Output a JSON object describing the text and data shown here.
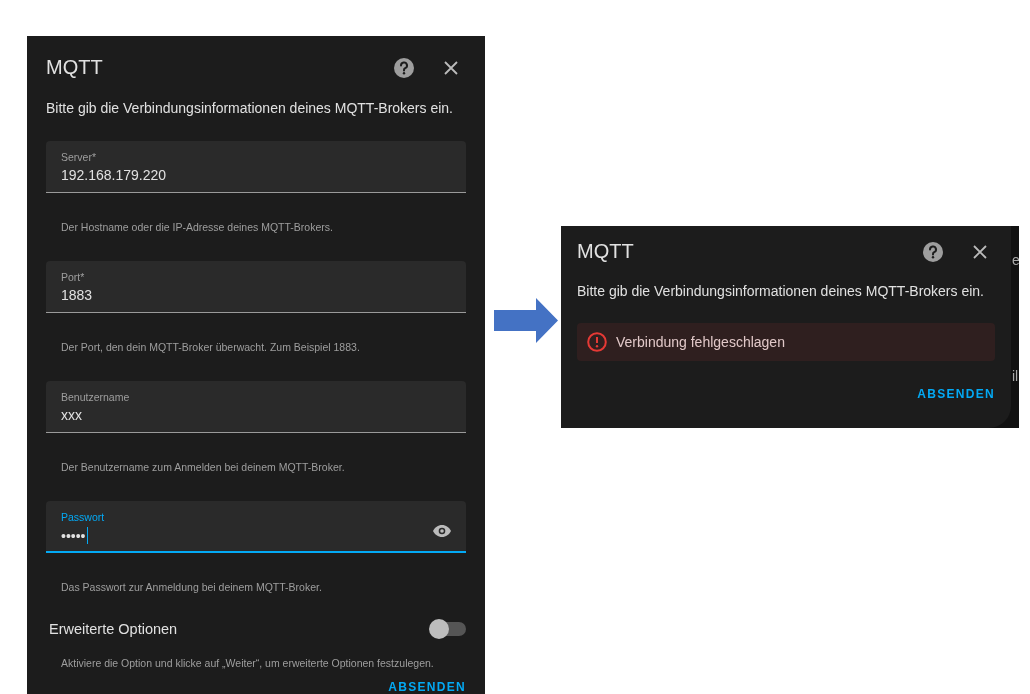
{
  "dialogs": [
    {
      "kind": "form",
      "title": "MQTT",
      "description": "Bitte gib die Verbindungsinformationen deines MQTT-Brokers ein.",
      "fields": [
        {
          "kind": "text",
          "label": "Server*",
          "value": "192.168.179.220",
          "helper": "Der Hostname oder die IP-Adresse deines MQTT-Brokers.",
          "focused": false
        },
        {
          "kind": "text",
          "label": "Port*",
          "value": "1883",
          "helper": "Der Port, den dein MQTT-Broker überwacht. Zum Beispiel 1883.",
          "focused": false
        },
        {
          "kind": "text",
          "label": "Benutzername",
          "value": "xxx",
          "helper": "Der Benutzername zum Anmelden bei deinem MQTT-Broker.",
          "focused": false
        },
        {
          "kind": "password",
          "label": "Passwort",
          "value": "•••••",
          "helper": "Das Passwort zur Anmeldung bei deinem MQTT-Broker.",
          "focused": true
        }
      ],
      "toggle": {
        "label": "Erweiterte Optionen",
        "on": false,
        "helper": "Aktiviere die Option und klicke auf „Weiter“, um erweiterte Optionen festzulegen."
      },
      "submit": "ABSENDEN"
    },
    {
      "kind": "error",
      "title": "MQTT",
      "description": "Bitte gib die Verbindungsinformationen deines MQTT-Brokers ein.",
      "error": "Verbindung fehlgeschlagen",
      "submit": "ABSENDEN",
      "background_fragments": [
        "e",
        "il"
      ]
    }
  ]
}
